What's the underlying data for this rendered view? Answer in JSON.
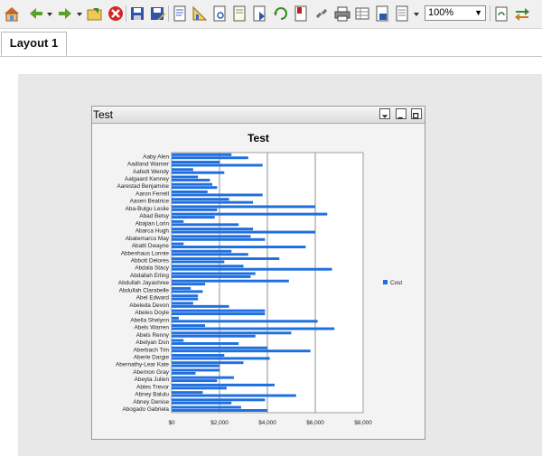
{
  "toolbar": {
    "icons": [
      "home-icon",
      "back-arrow-icon",
      "dropdown-icon",
      "forward-arrow-icon",
      "dropdown-icon",
      "open-folder-icon",
      "close-report-icon",
      "save-icon",
      "save-as-icon",
      "report-doc-icon",
      "chart-design-icon",
      "view-doc-icon",
      "page-doc-icon",
      "export-doc-icon",
      "refresh-icon",
      "bookmark-icon",
      "link-icon",
      "print-icon",
      "export-csv-icon",
      "export-pdf-icon",
      "export-more-icon",
      "dropdown-icon",
      "fit-icon",
      "filter-arrows-icon"
    ],
    "zoom_value": "100%"
  },
  "tabs": [
    {
      "label": "Layout 1"
    }
  ],
  "window": {
    "title": "Test"
  },
  "chart_data": {
    "type": "bar",
    "orientation": "horizontal",
    "title": "Test",
    "xlabel": "",
    "ylabel": "",
    "xlim": [
      0,
      8000
    ],
    "x_ticks": [
      "$0",
      "$2,000",
      "$4,000",
      "$6,000",
      "$8,000"
    ],
    "grid": true,
    "legend_position": "right",
    "categories": [
      "Aaby Alen",
      "Aadland Warner",
      "Aafedt Wendy",
      "Aalgaard Kenney",
      "Aarestad Benjamine",
      "Aaron Ferrell",
      "Aasen Beatrice",
      "Aba-Bulgu Leslie",
      "Abad Betsy",
      "Abajian Lorin",
      "Abarca Hugh",
      "Abatemarco May",
      "Abatti Dwayne",
      "Abbenhaus Lonnie",
      "Abbott Delores",
      "Abdala Stacy",
      "Abdallah Erling",
      "Abdullah Jayashree",
      "Abdullah Clarabelle",
      "Abel Edward",
      "Abeleda Devon",
      "Abeles Doyle",
      "Abella Shelynn",
      "Abels Warren",
      "Abels Renny",
      "Abelyan Don",
      "Aberbach Tim",
      "Aberle Dargie",
      "Abernathy-Lear Kate",
      "Abernon Gray",
      "Abeyta Julien",
      "Ables Trevor",
      "Abney Balulu",
      "Abney Denise",
      "Abogado Gabriela"
    ],
    "series": [
      {
        "name": "Cost",
        "color": "#1f6fe0",
        "values": [
          [
            2500,
            3200
          ],
          [
            2000,
            3800
          ],
          [
            900,
            2200
          ],
          [
            1100,
            1600
          ],
          [
            1700,
            1900
          ],
          [
            1500,
            3800
          ],
          [
            2400,
            3400
          ],
          [
            6000,
            1900
          ],
          [
            6500,
            1800
          ],
          [
            500,
            2800
          ],
          [
            3400,
            6000
          ],
          [
            3300,
            3900
          ],
          [
            500,
            5600
          ],
          [
            2500,
            3200
          ],
          [
            4500,
            2200
          ],
          [
            3000,
            6700
          ],
          [
            3500,
            3300
          ],
          [
            4900,
            1400
          ],
          [
            800,
            1300
          ],
          [
            1100,
            1100
          ],
          [
            900,
            2400
          ],
          [
            3900,
            3900
          ],
          [
            300,
            6100
          ],
          [
            1400,
            6800
          ],
          [
            5000,
            3500
          ],
          [
            500,
            2800
          ],
          [
            4000,
            5800
          ],
          [
            2200,
            4100
          ],
          [
            3000,
            2000
          ],
          [
            2000,
            1000
          ],
          [
            2600,
            1900
          ],
          [
            4300,
            2300
          ],
          [
            1300,
            5200
          ],
          [
            3900,
            2500
          ],
          [
            2900,
            4000
          ]
        ]
      }
    ]
  }
}
